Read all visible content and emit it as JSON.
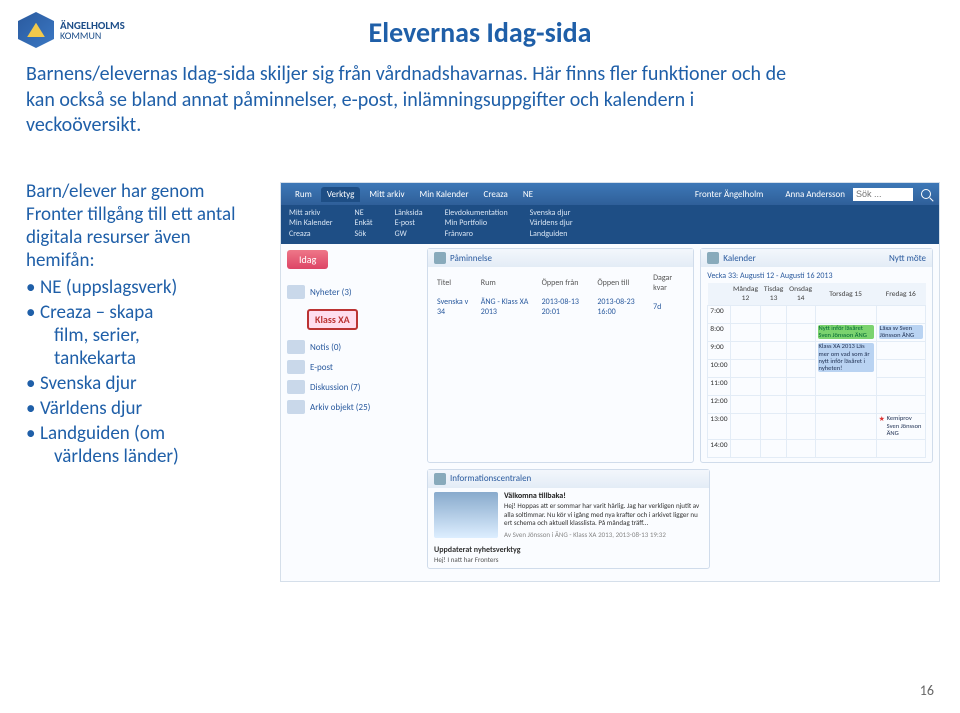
{
  "logo": {
    "line1": "ÄNGELHOLMS",
    "line2": "KOMMUN"
  },
  "page_title": "Elevernas Idag-sida",
  "intro": "Barnens/elevernas Idag-sida skiljer sig från vårdnadshavarnas. Här finns fler funktioner och de kan också se bland annat påminnelser, e-post, inlämningsuppgifter och kalendern i veckoöversikt.",
  "left": {
    "p1": "Barn/elever har genom Fronter tillgång till ett antal digitala resurser även hemifån:",
    "b1": "NE (uppslagsverk)",
    "b2_a": "Creaza – skapa",
    "b2_b": "film, serier,",
    "b2_c": "tankekarta",
    "b3": "Svenska djur",
    "b4": "Världens djur",
    "b5_a": "Landguiden (om",
    "b5_b": "världens länder)"
  },
  "shot": {
    "brand": "Fronter Ängelholm",
    "tabs": [
      "Rum",
      "Verktyg",
      "Mitt arkiv",
      "Min Kalender",
      "Creaza",
      "NE"
    ],
    "active_tab": 1,
    "user": "Anna Andersson",
    "search_ph": "Sök ...",
    "links": {
      "c1": [
        "Mitt arkiv",
        "Min Kalender",
        "Creaza"
      ],
      "c2": [
        "NE",
        "Enkät",
        "Sök"
      ],
      "c3": [
        "Länksida",
        "E-post",
        "GW"
      ],
      "c4": [
        "Elevdokumentation",
        "Min Portfolio",
        "Frånvaro"
      ],
      "c5": [
        "Svenska djur",
        "Världens djur",
        "Landguiden"
      ]
    },
    "idag_btn": "Idag",
    "class_badge": "Klass XA",
    "sidebar": [
      {
        "label": "Nyheter (3)"
      },
      {
        "label": "Notis (0)"
      },
      {
        "label": "E-post"
      },
      {
        "label": "Diskussion (7)"
      },
      {
        "label": "Arkiv objekt (25)"
      }
    ],
    "pam": {
      "title": "Påminnelse",
      "cols": [
        "Titel",
        "Rum",
        "Öppen från",
        "Öppen till",
        "Dagar kvar"
      ],
      "row": {
        "titel": "Svenska v 34",
        "rum": "ÄNG - Klass XA 2013",
        "fr": "2013-08-13 20:01",
        "till": "2013-08-23 16:00",
        "kvar": "7d"
      }
    },
    "cal": {
      "title": "Kalender",
      "action": "Nytt möte",
      "week": "Vecka 33: Augusti 12 - Augusti 16 2013",
      "days": [
        "Måndag 12",
        "Tisdag 13",
        "Onsdag 14",
        "Torsdag 15",
        "Fredag 16"
      ],
      "hours": [
        "7:00",
        "8:00",
        "9:00",
        "10:00",
        "11:00",
        "12:00",
        "13:00",
        "14:00"
      ],
      "ev1": "Nytt inför läsåret Sven Jönsson ÄNG",
      "ev2": "Läxa sv Sven Jönsson ÄNG",
      "ev3": "Klass XA 2013 Läs mer om vad som är nytt inför läsåret i nyheten!",
      "ev4": "Kemiprov Sven Jönsson ÄNG"
    },
    "info": {
      "title": "Informationscentralen",
      "h": "Välkomna tillbaka!",
      "body": "Hej! Hoppas att er sommar har varit härlig. Jag har verkligen njutit av alla soltimmar. Nu kör vi igång med nya krafter och i arkivet ligger nu ert schema och aktuell klasslista. På måndag träff...",
      "by": "Av Sven Jönsson i ÄNG - Klass XA 2013, 2013-08-13 19:32",
      "h2": "Uppdaterat nyhetsverktyg",
      "body2": "Hej! I natt har Fronters"
    }
  },
  "page_num": "16"
}
